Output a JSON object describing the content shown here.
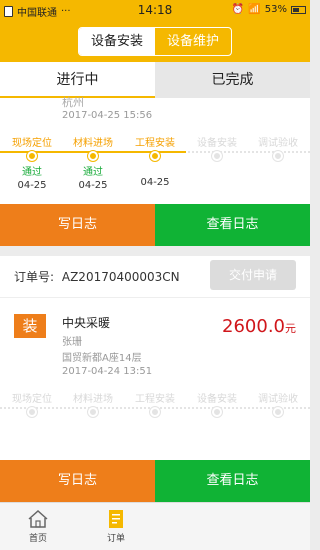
{
  "status_bar": {
    "carrier": "中国联通",
    "dots": "···",
    "time": "14:18",
    "battery": "53%"
  },
  "header": {
    "segments": [
      "设备安装",
      "设备维护"
    ],
    "active_segment": 0
  },
  "tabs": [
    "进行中",
    "已完成"
  ],
  "card1": {
    "clipped_text": "杭州",
    "datetime": "2017-04-25 15:56",
    "steps": [
      {
        "label": "现场定位",
        "status": "通过",
        "date": "04-25",
        "done": true
      },
      {
        "label": "材料进场",
        "status": "通过",
        "date": "04-25",
        "done": true
      },
      {
        "label": "工程安装",
        "status": "",
        "date": "04-25",
        "done": true
      },
      {
        "label": "设备安装",
        "status": "",
        "date": "",
        "done": false
      },
      {
        "label": "调试验收",
        "status": "",
        "date": "",
        "done": false
      }
    ],
    "write_log": "写日志",
    "view_log": "查看日志"
  },
  "card2": {
    "order_label": "订单号:",
    "order_no": "AZ20170400003CN",
    "submit": "交付申请",
    "badge": "装",
    "service_name": "中央采暖",
    "person": "张珊",
    "address": "国贸新都A座14层",
    "datetime": "2017-04-24 13:51",
    "price": "2600.0",
    "price_unit": "元",
    "steps": [
      {
        "label": "现场定位",
        "done": false
      },
      {
        "label": "材料进场",
        "done": false
      },
      {
        "label": "工程安装",
        "done": false
      },
      {
        "label": "设备安装",
        "done": false
      },
      {
        "label": "调试验收",
        "done": false
      }
    ],
    "write_log": "写日志",
    "view_log": "查看日志"
  },
  "nav": {
    "home": "首页",
    "orders": "订单"
  },
  "colors": {
    "accent": "#f5b800",
    "orange": "#ee7e1a",
    "green": "#10b335",
    "price": "#d0161b"
  }
}
